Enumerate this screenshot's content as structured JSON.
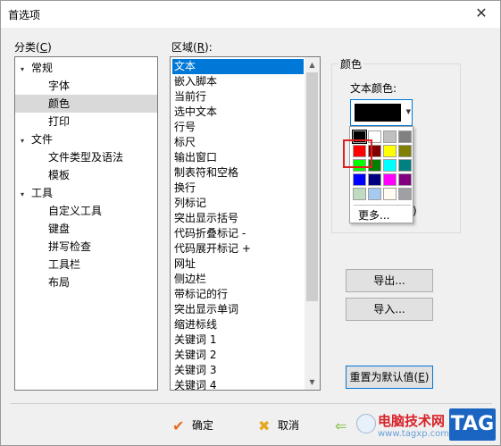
{
  "window": {
    "title": "首选项",
    "close_glyph": "✕"
  },
  "category": {
    "label": "分类(",
    "accel": "C",
    "label_end": ")",
    "tree": [
      {
        "text": "常规",
        "expander": "▾",
        "level": 0
      },
      {
        "text": "字体",
        "level": 1
      },
      {
        "text": "颜色",
        "level": 1,
        "selected": true
      },
      {
        "text": "打印",
        "level": 1
      },
      {
        "text": "文件",
        "expander": "▾",
        "level": 0
      },
      {
        "text": "文件类型及语法",
        "level": 1
      },
      {
        "text": "模板",
        "level": 1
      },
      {
        "text": "工具",
        "expander": "▾",
        "level": 0
      },
      {
        "text": "自定义工具",
        "level": 1
      },
      {
        "text": "键盘",
        "level": 1
      },
      {
        "text": "拼写检查",
        "level": 1
      },
      {
        "text": "工具栏",
        "level": 1
      },
      {
        "text": "布局",
        "level": 1
      }
    ]
  },
  "area": {
    "label": "区域(",
    "accel": "R",
    "label_end": "):",
    "items": [
      "文本",
      "嵌入脚本",
      "当前行",
      "选中文本",
      "行号",
      "标尺",
      "输出窗口",
      "制表符和空格",
      "换行",
      "列标记",
      "突出显示括号",
      "代码折叠标记 -",
      "代码展开标记 +",
      "网址",
      "侧边栏",
      "带标记的行",
      "突出显示单词",
      "缩进标线",
      "关键词 1",
      "关键词 2",
      "关键词 3",
      "关键词 4"
    ],
    "selected_index": 0,
    "scroll_up": "▲",
    "scroll_down": "▼"
  },
  "color_group": {
    "title": "颜色",
    "text_color_label": "文本颜色:",
    "current_color": "#000000",
    "dropdown_glyph": "▼",
    "palette": [
      [
        "#000000",
        "#ffffff",
        "#c0c0c0",
        "#808080"
      ],
      [
        "#ff0000",
        "#800000",
        "#ffff00",
        "#808000"
      ],
      [
        "#00ff00",
        "#008000",
        "#00ffff",
        "#008080"
      ],
      [
        "#0000ff",
        "#000080",
        "#ff00ff",
        "#800080"
      ],
      [
        "#c0dcc0",
        "#a6caf0",
        "#fffbf0",
        "#a0a0a4"
      ]
    ],
    "more_label": "更多...",
    "hidden_tail": ")"
  },
  "buttons": {
    "export": "导出...",
    "import": "导入...",
    "reset": "重置为默认值(",
    "reset_accel": "E",
    "reset_end": ")",
    "ok": "确定",
    "cancel": "取消"
  },
  "icons": {
    "ok": "check-icon",
    "cancel": "x-icon",
    "apply": "arrow-icon"
  },
  "watermark": {
    "text": "电脑技术网",
    "url": "www.tagxp.com",
    "tag": "TAG"
  }
}
